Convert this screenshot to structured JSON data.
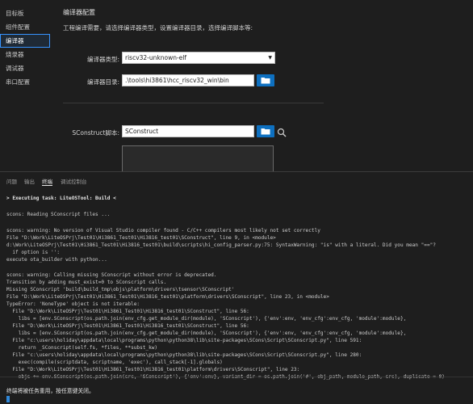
{
  "nav": {
    "items": [
      {
        "label": "目标板",
        "active": false
      },
      {
        "label": "组件配置",
        "active": false
      },
      {
        "label": "编译器",
        "active": true
      },
      {
        "label": "烧录器",
        "active": false
      },
      {
        "label": "调试器",
        "active": false
      },
      {
        "label": "串口配置",
        "active": false
      }
    ]
  },
  "config": {
    "title": "编译器配置",
    "description": "工程编译需要，请选择编译器类型，设置编译器目录，选择编译脚本等:",
    "compiler_type_label": "编译器类型:",
    "compiler_type_value": "riscv32-unknown-elf",
    "compiler_dir_label": "编译器目录:",
    "compiler_dir_value": ".\\tools\\hi3861\\hcc_riscv32_win\\bin",
    "script_label": "SConstruct脚本:",
    "script_value": "SConstruct"
  },
  "terminal": {
    "tabs": [
      {
        "label": "问题",
        "active": false
      },
      {
        "label": "输出",
        "active": false
      },
      {
        "label": "终端",
        "active": true
      },
      {
        "label": "调试控制台",
        "active": false
      }
    ],
    "lines": [
      {
        "text": "> Executing task: LiteOSTool: Build <",
        "bold": true
      },
      {
        "text": "",
        "bold": false
      },
      {
        "text": "scons: Reading SConscript files ...",
        "bold": false
      },
      {
        "text": "",
        "bold": false
      },
      {
        "text": "scons: warning: No version of Visual Studio compiler found - C/C++ compilers most likely not set correctly",
        "bold": false
      },
      {
        "text": "File \"D:\\Work\\LiteOSPrj\\Test01\\Hi3861_Test01\\Hi3816_test01\\SConstruct\", line 9, in <module>",
        "bold": false
      },
      {
        "text": "d:\\Work\\LiteOSPrj\\Test01\\Hi3861_Test01\\Hi3816_test01\\build\\scripts\\hi_config_parser.py:75: SyntaxWarning: \"is\" with a literal. Did you mean \"==\"?",
        "bold": false
      },
      {
        "text": "  if option is '':",
        "bold": false
      },
      {
        "text": "execute ota_builder with python...",
        "bold": false
      },
      {
        "text": "",
        "bold": false
      },
      {
        "text": "scons: warning: Calling missing SConscript without error is deprecated.",
        "bold": false
      },
      {
        "text": "Transition by adding must_exist=0 to SConscript calls.",
        "bold": false
      },
      {
        "text": "Missing SConscript 'build\\build_tmp\\objs\\platform\\drivers\\tsensor\\SConscript'",
        "bold": false
      },
      {
        "text": "File \"D:\\Work\\LiteOSPrj\\Test01\\Hi3861_Test01\\Hi3816_test01\\platform\\drivers\\SConscript\", line 23, in <module>",
        "bold": false
      },
      {
        "text": "TypeError: 'NoneType' object is not iterable:",
        "bold": false
      },
      {
        "text": "  File \"D:\\Work\\LiteOSPrj\\Test01\\Hi3861_Test01\\Hi3816_test01\\SConstruct\", line 56:",
        "bold": false
      },
      {
        "text": "    libs = [env.SConscript(os.path.join(env_cfg.get_module_dir(module), 'SConscript'), {'env':env, 'env_cfg':env_cfg, 'module':module},",
        "bold": false
      },
      {
        "text": "  File \"D:\\Work\\LiteOSPrj\\Test01\\Hi3861_Test01\\Hi3816_test01\\SConstruct\", line 56:",
        "bold": false
      },
      {
        "text": "    libs = [env.SConscript(os.path.join(env_cfg.get_module_dir(module), 'SConscript'), {'env':env, 'env_cfg':env_cfg, 'module':module},",
        "bold": false
      },
      {
        "text": "  File \"c:\\users\\holiday\\appdata\\local\\programs\\python\\python38\\lib\\site-packages\\SCons\\Script\\SConscript.py\", line 591:",
        "bold": false
      },
      {
        "text": "    return _SConscript(self.fs, *files, **subst_kw)",
        "bold": false
      },
      {
        "text": "  File \"c:\\users\\holiday\\appdata\\local\\programs\\python\\python38\\lib\\site-packages\\SCons\\Script\\SConscript.py\", line 280:",
        "bold": false
      },
      {
        "text": "    exec(compile(scriptdata, scriptname, 'exec'), call_stack[-1].globals)",
        "bold": false
      },
      {
        "text": "  File \"D:\\Work\\LiteOSPrj\\Test01\\Hi3861_Test01\\Hi3816_test01\\platform\\drivers\\SConscript\", line 23:",
        "bold": false
      },
      {
        "text": "    objs += env.SConscript(os.path.join(src, 'SConscript'), {'env':env}, variant_dir = os.path.join('#', obj_path, module_path, src), duplicate = 0)",
        "bold": false
      }
    ],
    "final_message": "终端将被任务重用，按任意键关闭。"
  },
  "colors": {
    "accent": "#3794ff",
    "button_blue": "#0e70c0",
    "background": "#1e1e1e"
  },
  "icons": [
    "chevron-down-icon",
    "folder-icon",
    "search-icon"
  ]
}
